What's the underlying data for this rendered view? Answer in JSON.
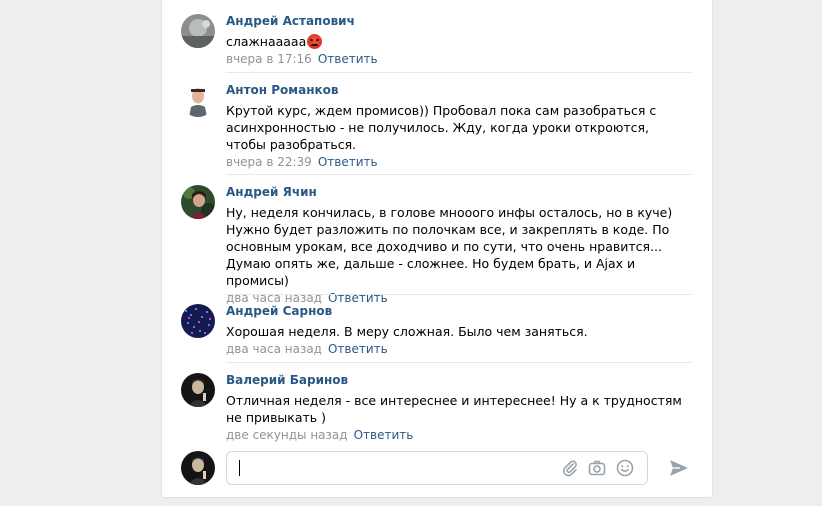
{
  "comments": [
    {
      "author": "Андрей Астапович",
      "text": "слажнааааа",
      "emoji": "angry-face",
      "time": "вчера в 17:16",
      "reply": "Ответить"
    },
    {
      "author": "Антон Романков",
      "text": "Крутой курс, ждем промисов)) Пробовал пока сам разобраться с асинхронностью - не получилось. Жду, когда уроки откроются, чтобы разобраться.",
      "time": "вчера в 22:39",
      "reply": "Ответить"
    },
    {
      "author": "Андрей Ячин",
      "text": "Ну, неделя кончилась, в голове мнооого инфы осталось, но в куче) Нужно будет разложить по полочкам все, и закреплять в коде. По основным урокам, все доходчиво и по сути, что очень нравится... Думаю опять же, дальше - сложнее. Но будем брать, и Ajax и промисы)",
      "time": "два часа назад",
      "reply": "Ответить"
    },
    {
      "author": "Андрей Сарнов",
      "text": "Хорошая неделя. В меру сложная. Было чем заняться.",
      "time": "два часа назад",
      "reply": "Ответить"
    },
    {
      "author": "Валерий Баринов",
      "text": "Отличная неделя - все интереснее и интереснее! Ну а к трудностям не привыкать )",
      "time": "две секунды назад",
      "reply": "Ответить"
    }
  ],
  "composer": {
    "value": "",
    "icons": [
      "paperclip-icon",
      "camera-icon",
      "smile-icon"
    ],
    "send_icon": "send-arrow-icon"
  },
  "colors": {
    "link": "#2a5885",
    "meta": "#939393",
    "background": "#edeef0",
    "icon": "#99a2ad"
  }
}
